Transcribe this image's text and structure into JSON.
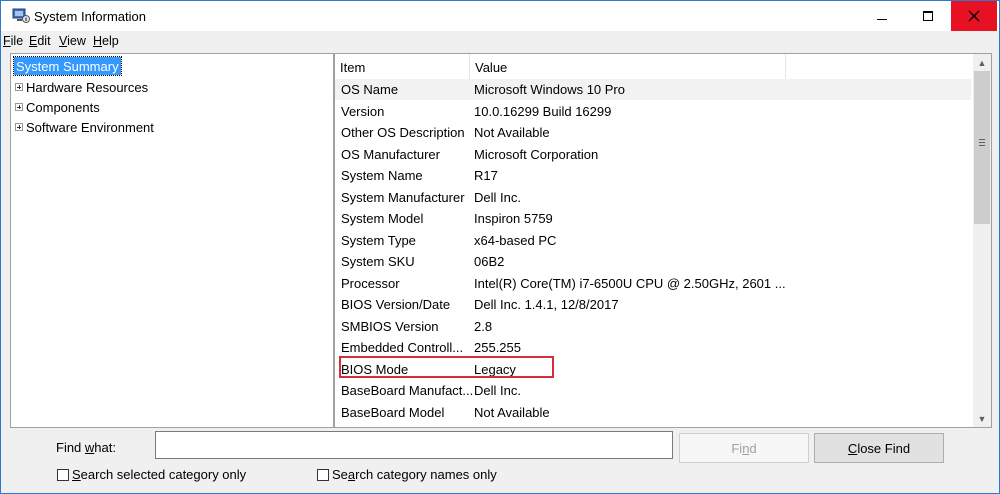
{
  "window": {
    "title": "System Information",
    "accent": "#2b79d0",
    "close_color": "#e81123"
  },
  "menu": [
    {
      "key": "F",
      "rest": "ile"
    },
    {
      "key": "E",
      "rest": "dit"
    },
    {
      "key": "V",
      "rest": "iew"
    },
    {
      "key": "H",
      "rest": "elp"
    }
  ],
  "tree": {
    "selected": "System Summary",
    "items": [
      "Hardware Resources",
      "Components",
      "Software Environment"
    ]
  },
  "list": {
    "headers": [
      "Item",
      "Value"
    ],
    "rows": [
      [
        "OS Name",
        "Microsoft Windows 10 Pro"
      ],
      [
        "Version",
        "10.0.16299 Build 16299"
      ],
      [
        "Other OS Description",
        "Not Available"
      ],
      [
        "OS Manufacturer",
        "Microsoft Corporation"
      ],
      [
        "System Name",
        "R17"
      ],
      [
        "System Manufacturer",
        "Dell Inc."
      ],
      [
        "System Model",
        "Inspiron 5759"
      ],
      [
        "System Type",
        "x64-based PC"
      ],
      [
        "System SKU",
        "06B2"
      ],
      [
        "Processor",
        "Intel(R) Core(TM) i7-6500U CPU @ 2.50GHz, 2601 ..."
      ],
      [
        "BIOS Version/Date",
        "Dell Inc. 1.4.1, 12/8/2017"
      ],
      [
        "SMBIOS Version",
        "2.8"
      ],
      [
        "Embedded Controll...",
        "255.255"
      ],
      [
        "BIOS Mode",
        "Legacy"
      ],
      [
        "BaseBoard Manufact...",
        "Dell Inc."
      ],
      [
        "BaseBoard Model",
        "Not Available"
      ]
    ],
    "highlight_color": "#d32f3a"
  },
  "find": {
    "label_pre": "Find ",
    "label_key": "w",
    "label_post": "hat:",
    "value": "",
    "find_button": {
      "pre": "Fi",
      "key": "n",
      "post": "d"
    },
    "close_find_button": {
      "pre": "",
      "key": "C",
      "post": "lose Find"
    },
    "check1": {
      "pre": "",
      "key": "S",
      "post": "earch selected category only"
    },
    "check2": {
      "pre": "Se",
      "key": "a",
      "post": "rch category names only"
    }
  }
}
